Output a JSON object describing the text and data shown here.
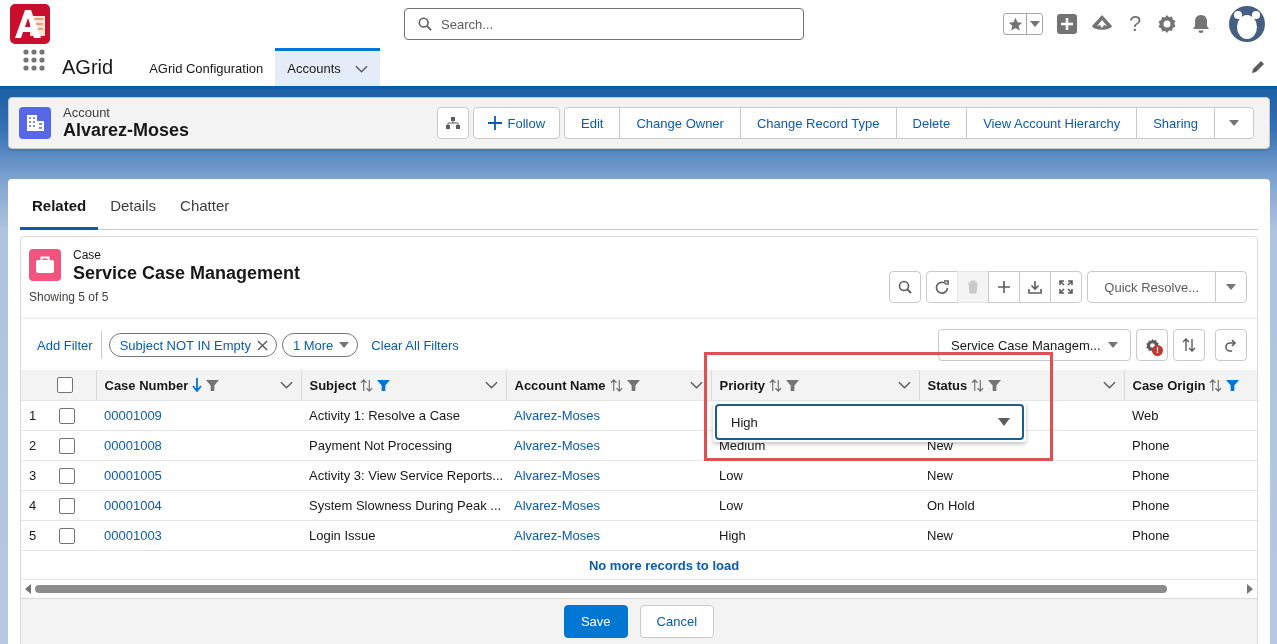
{
  "global_header": {
    "search": {
      "placeholder": "Search..."
    },
    "help_glyph": "?"
  },
  "nav": {
    "app_name": "AGrid",
    "tabs": [
      {
        "label": "AGrid Configuration",
        "selected": false,
        "has_menu": false
      },
      {
        "label": "Accounts",
        "selected": true,
        "has_menu": true
      }
    ]
  },
  "record": {
    "object_type": "Account",
    "name": "Alvarez-Moses",
    "actions": [
      {
        "label": "Follow",
        "kind": "follow"
      },
      {
        "label": "Edit",
        "kind": "standard"
      },
      {
        "label": "Change Owner",
        "kind": "standard"
      },
      {
        "label": "Change Record Type",
        "kind": "standard"
      },
      {
        "label": "Delete",
        "kind": "standard"
      },
      {
        "label": "View Account Hierarchy",
        "kind": "standard"
      },
      {
        "label": "Sharing",
        "kind": "standard"
      }
    ]
  },
  "page_tabs": [
    {
      "label": "Related",
      "selected": true
    },
    {
      "label": "Details",
      "selected": false
    },
    {
      "label": "Chatter",
      "selected": false
    }
  ],
  "related_list": {
    "object_type": "Case",
    "title": "Service Case Management",
    "count": "Showing 5 of 5",
    "toolbar": [
      {
        "kind": "search",
        "disabled": false
      },
      {
        "kind": "refresh",
        "disabled": false
      },
      {
        "kind": "delete",
        "disabled": true
      },
      {
        "kind": "add",
        "disabled": false
      },
      {
        "kind": "download",
        "disabled": false
      },
      {
        "kind": "expand",
        "disabled": false
      }
    ],
    "quick_action": "Quick Resolve...",
    "filters": {
      "add_label": "Add Filter",
      "chips": [
        {
          "label": "Subject NOT IN Empty",
          "kind": "removable"
        },
        {
          "label": "1 More",
          "kind": "menu"
        }
      ],
      "clear_label": "Clear All Filters"
    },
    "view_select": "Service Case Managem...",
    "settings_badge": "!",
    "table": {
      "select_all_checked": false,
      "columns": [
        {
          "label": "Case Number",
          "sorted_descending": true,
          "filter_active": false,
          "has_menu": true
        },
        {
          "label": "Subject",
          "sorted_descending": false,
          "filter_active": true,
          "has_menu": true
        },
        {
          "label": "Account Name",
          "sorted_descending": false,
          "filter_active": false,
          "has_menu": true
        },
        {
          "label": "Priority",
          "sorted_descending": false,
          "filter_active": false,
          "has_menu": true
        },
        {
          "label": "Status",
          "sorted_descending": false,
          "filter_active": false,
          "has_menu": true
        },
        {
          "label": "Case Origin",
          "sorted_descending": false,
          "filter_active": true,
          "has_menu": false
        }
      ],
      "rows": [
        {
          "number": "1",
          "checked": false,
          "cells": [
            {
              "kind": "link",
              "text": "00001009"
            },
            {
              "kind": "text",
              "text": "Activity 1: Resolve a Case"
            },
            {
              "kind": "link",
              "text": "Alvarez-Moses"
            },
            {
              "kind": "editor",
              "value": "High"
            },
            {
              "kind": "covered"
            },
            {
              "kind": "text",
              "text": "Web"
            }
          ]
        },
        {
          "number": "2",
          "checked": false,
          "cells": [
            {
              "kind": "link",
              "text": "00001008"
            },
            {
              "kind": "text",
              "text": "Payment Not Processing"
            },
            {
              "kind": "link",
              "text": "Alvarez-Moses"
            },
            {
              "kind": "text",
              "text": "Medium"
            },
            {
              "kind": "text",
              "text": "New"
            },
            {
              "kind": "text",
              "text": "Phone"
            }
          ]
        },
        {
          "number": "3",
          "checked": false,
          "cells": [
            {
              "kind": "link",
              "text": "00001005"
            },
            {
              "kind": "text",
              "text": "Activity 3: View Service Reports..."
            },
            {
              "kind": "link",
              "text": "Alvarez-Moses"
            },
            {
              "kind": "text",
              "text": "Low"
            },
            {
              "kind": "text",
              "text": "New"
            },
            {
              "kind": "text",
              "text": "Phone"
            }
          ]
        },
        {
          "number": "4",
          "checked": false,
          "cells": [
            {
              "kind": "link",
              "text": "00001004"
            },
            {
              "kind": "text",
              "text": "System Slowness During Peak ..."
            },
            {
              "kind": "link",
              "text": "Alvarez-Moses"
            },
            {
              "kind": "text",
              "text": "Low"
            },
            {
              "kind": "text",
              "text": "On Hold"
            },
            {
              "kind": "text",
              "text": "Phone"
            }
          ]
        },
        {
          "number": "5",
          "checked": false,
          "cells": [
            {
              "kind": "link",
              "text": "00001003"
            },
            {
              "kind": "text",
              "text": "Login Issue"
            },
            {
              "kind": "link",
              "text": "Alvarez-Moses"
            },
            {
              "kind": "text",
              "text": "High"
            },
            {
              "kind": "text",
              "text": "New"
            },
            {
              "kind": "text",
              "text": "Phone"
            }
          ]
        }
      ],
      "footer_message": "No more records to load"
    },
    "buttons": [
      {
        "label": "Save",
        "kind": "brand"
      },
      {
        "label": "Cancel",
        "kind": "neutral"
      }
    ]
  }
}
